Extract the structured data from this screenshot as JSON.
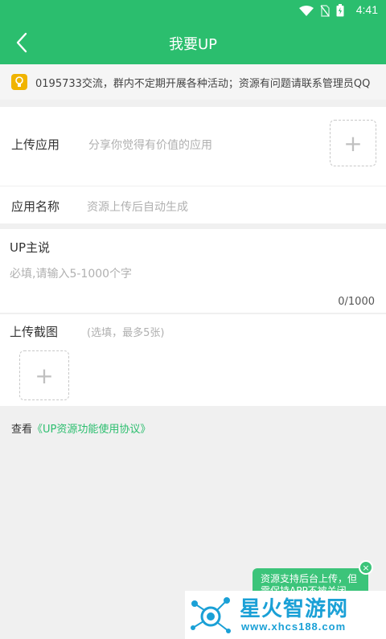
{
  "status_bar": {
    "time": "4:41"
  },
  "app_bar": {
    "title": "我要UP"
  },
  "notice": {
    "text": "0195733交流，群内不定期开展各种活动；资源有问题请联系管理员QQ"
  },
  "upload_app": {
    "label": "上传应用",
    "placeholder": "分享你觉得有价值的应用",
    "add_symbol": "+"
  },
  "app_name": {
    "label": "应用名称",
    "placeholder": "资源上传后自动生成"
  },
  "up_says": {
    "label": "UP主说",
    "placeholder": "必填,请输入5-1000个字",
    "counter": "0/1000"
  },
  "screenshots": {
    "label": "上传截图",
    "hint": "(选填，最多5张)",
    "add_symbol": "+"
  },
  "agreement": {
    "prefix": "查看",
    "link": "《UP资源功能使用协议》"
  },
  "toast": {
    "line1": "资源支持后台上传，但",
    "line2": "需保持APP不被关闭",
    "close": "×"
  },
  "watermark": {
    "name": "星火智游网",
    "url": "www.xhcs188.com"
  },
  "colors": {
    "primary": "#2bbe6e",
    "hint": "#b0b0b0",
    "background": "#f0f0f0",
    "bulb": "#f0b400",
    "watermark": "#1aa0d6"
  }
}
